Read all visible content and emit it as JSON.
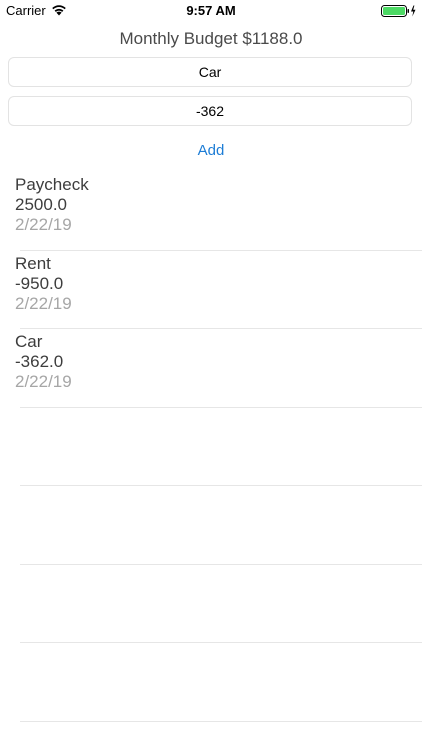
{
  "status_bar": {
    "carrier": "Carrier",
    "time": "9:57 AM",
    "battery_level": 1.0
  },
  "header": {
    "title": "Monthly Budget $1188.0"
  },
  "form": {
    "name_value": "Car",
    "amount_value": "-362",
    "add_label": "Add"
  },
  "transactions": [
    {
      "name": "Paycheck",
      "amount": "2500.0",
      "date": "2/22/19"
    },
    {
      "name": "Rent",
      "amount": "-950.0",
      "date": "2/22/19"
    },
    {
      "name": "Car",
      "amount": "-362.0",
      "date": "2/22/19"
    }
  ],
  "colors": {
    "accent": "#1c7cd5",
    "battery": "#4cd964",
    "primary_text": "#3d3d3d",
    "secondary_text": "#a6a6a6",
    "separator": "#e6e6e6"
  }
}
